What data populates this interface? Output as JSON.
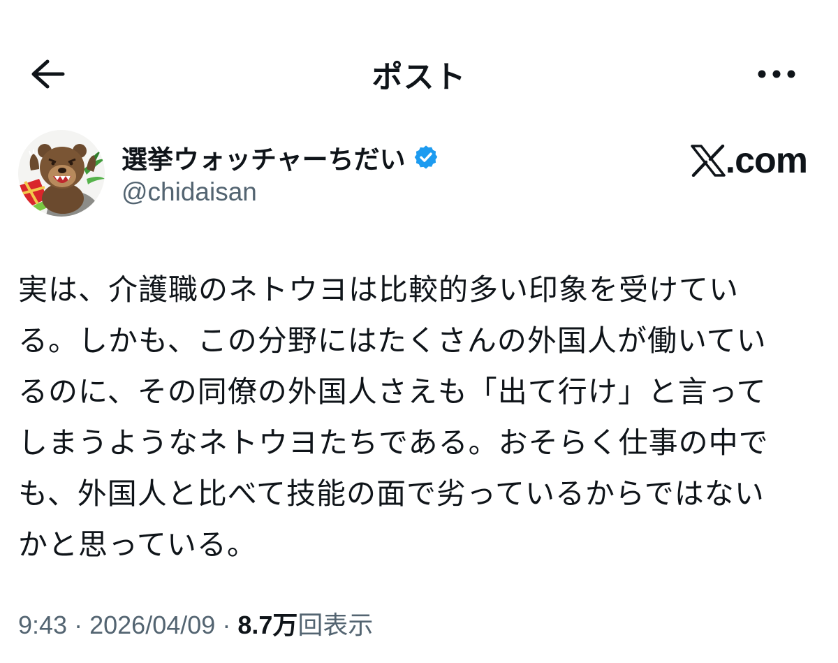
{
  "header": {
    "title": "ポスト"
  },
  "author": {
    "display_name": "選挙ウォッチャーちだい",
    "handle": "@chidaisan",
    "verified": true,
    "verified_color": "#1d9bf0"
  },
  "branding": {
    "site": "com",
    "logo": "x-logo-icon"
  },
  "post": {
    "lines": [
      "実は、介護職のネトウヨは比較的多い印象を受けてい",
      "る。しかも、この分野にはたくさんの外国人が働いてい",
      "るのに、その同僚の外国人さえも「出て行け」と言って",
      "しまうようなネトウヨたちである。おそらく仕事の中で",
      "も、外国人と比べて技能の面で劣っているからではない",
      "かと思っている。"
    ]
  },
  "meta": {
    "time": "9:43",
    "separator": "·",
    "date": "2026/04/09",
    "views_count": "8.7万",
    "views_label": "回表示"
  },
  "colors": {
    "text_primary": "#0f1419",
    "text_secondary": "#536471",
    "accent": "#1d9bf0"
  },
  "icons": {
    "back": "arrow-left-icon",
    "more": "more-horizontal-icon",
    "verified": "verified-badge-icon"
  }
}
